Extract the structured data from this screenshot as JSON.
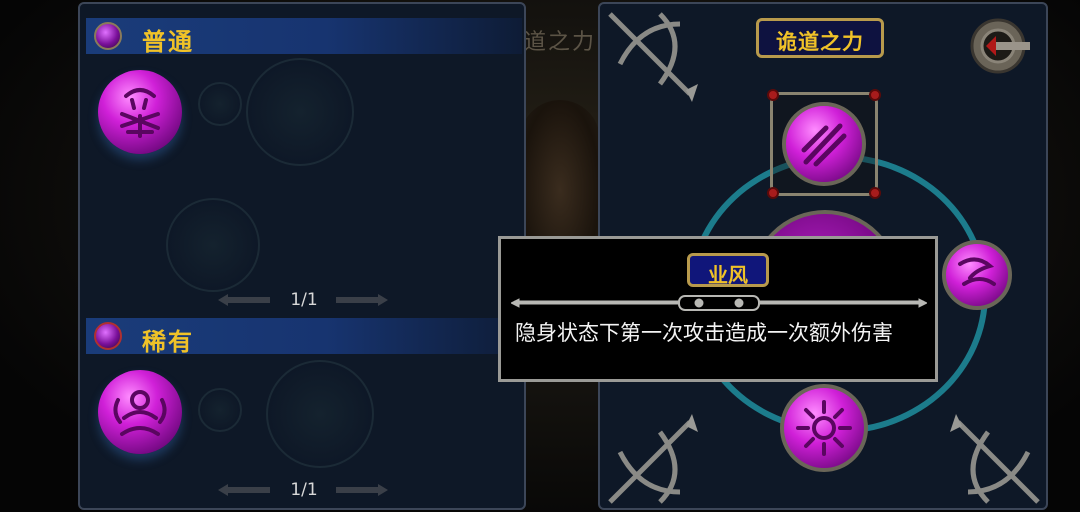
{
  "background": {
    "title": "诡道之力"
  },
  "left_panel": {
    "sections": [
      {
        "label": "普通",
        "gem_color": "#b030c8",
        "pager": "1/1"
      },
      {
        "label": "稀有",
        "gem_color": "#b030c8",
        "pager": "1/1"
      }
    ]
  },
  "right_panel": {
    "title": "诡道之力"
  },
  "tooltip": {
    "name": "业风",
    "description": "隐身状态下第一次攻击造成一次额外伤害"
  },
  "colors": {
    "gold": "#f0c228",
    "orb": "#d020d8",
    "panel": "#0e1827",
    "header_blue": "#1a3c7a"
  }
}
